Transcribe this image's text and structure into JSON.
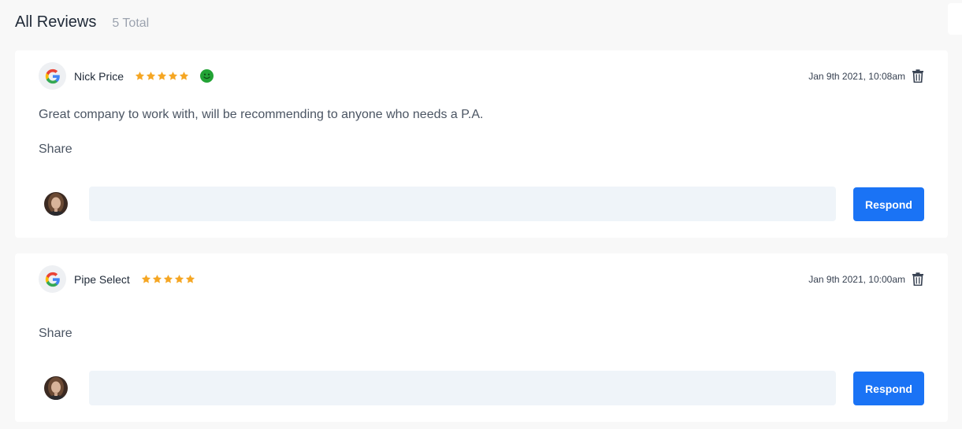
{
  "header": {
    "title": "All Reviews",
    "count": "5 Total"
  },
  "reviews": [
    {
      "source_icon": "google-icon",
      "reviewer": "Nick Price",
      "rating": 5,
      "sentiment_icon": "positive-sentiment-icon",
      "date": "Jan 9th 2021, 10:08am",
      "text": "Great company to work with, will be recommending to anyone who needs a P.A.",
      "share_label": "Share",
      "reply_placeholder": "",
      "respond_label": "Respond"
    },
    {
      "source_icon": "google-icon",
      "reviewer": "Pipe Select",
      "rating": 5,
      "date": "Jan 9th 2021, 10:00am",
      "text": "",
      "share_label": "Share",
      "reply_placeholder": "",
      "respond_label": "Respond"
    }
  ],
  "colors": {
    "accent": "#1a73f5",
    "star": "#f5a623",
    "positive": "#22a335",
    "input_bg": "#eff4f9"
  }
}
